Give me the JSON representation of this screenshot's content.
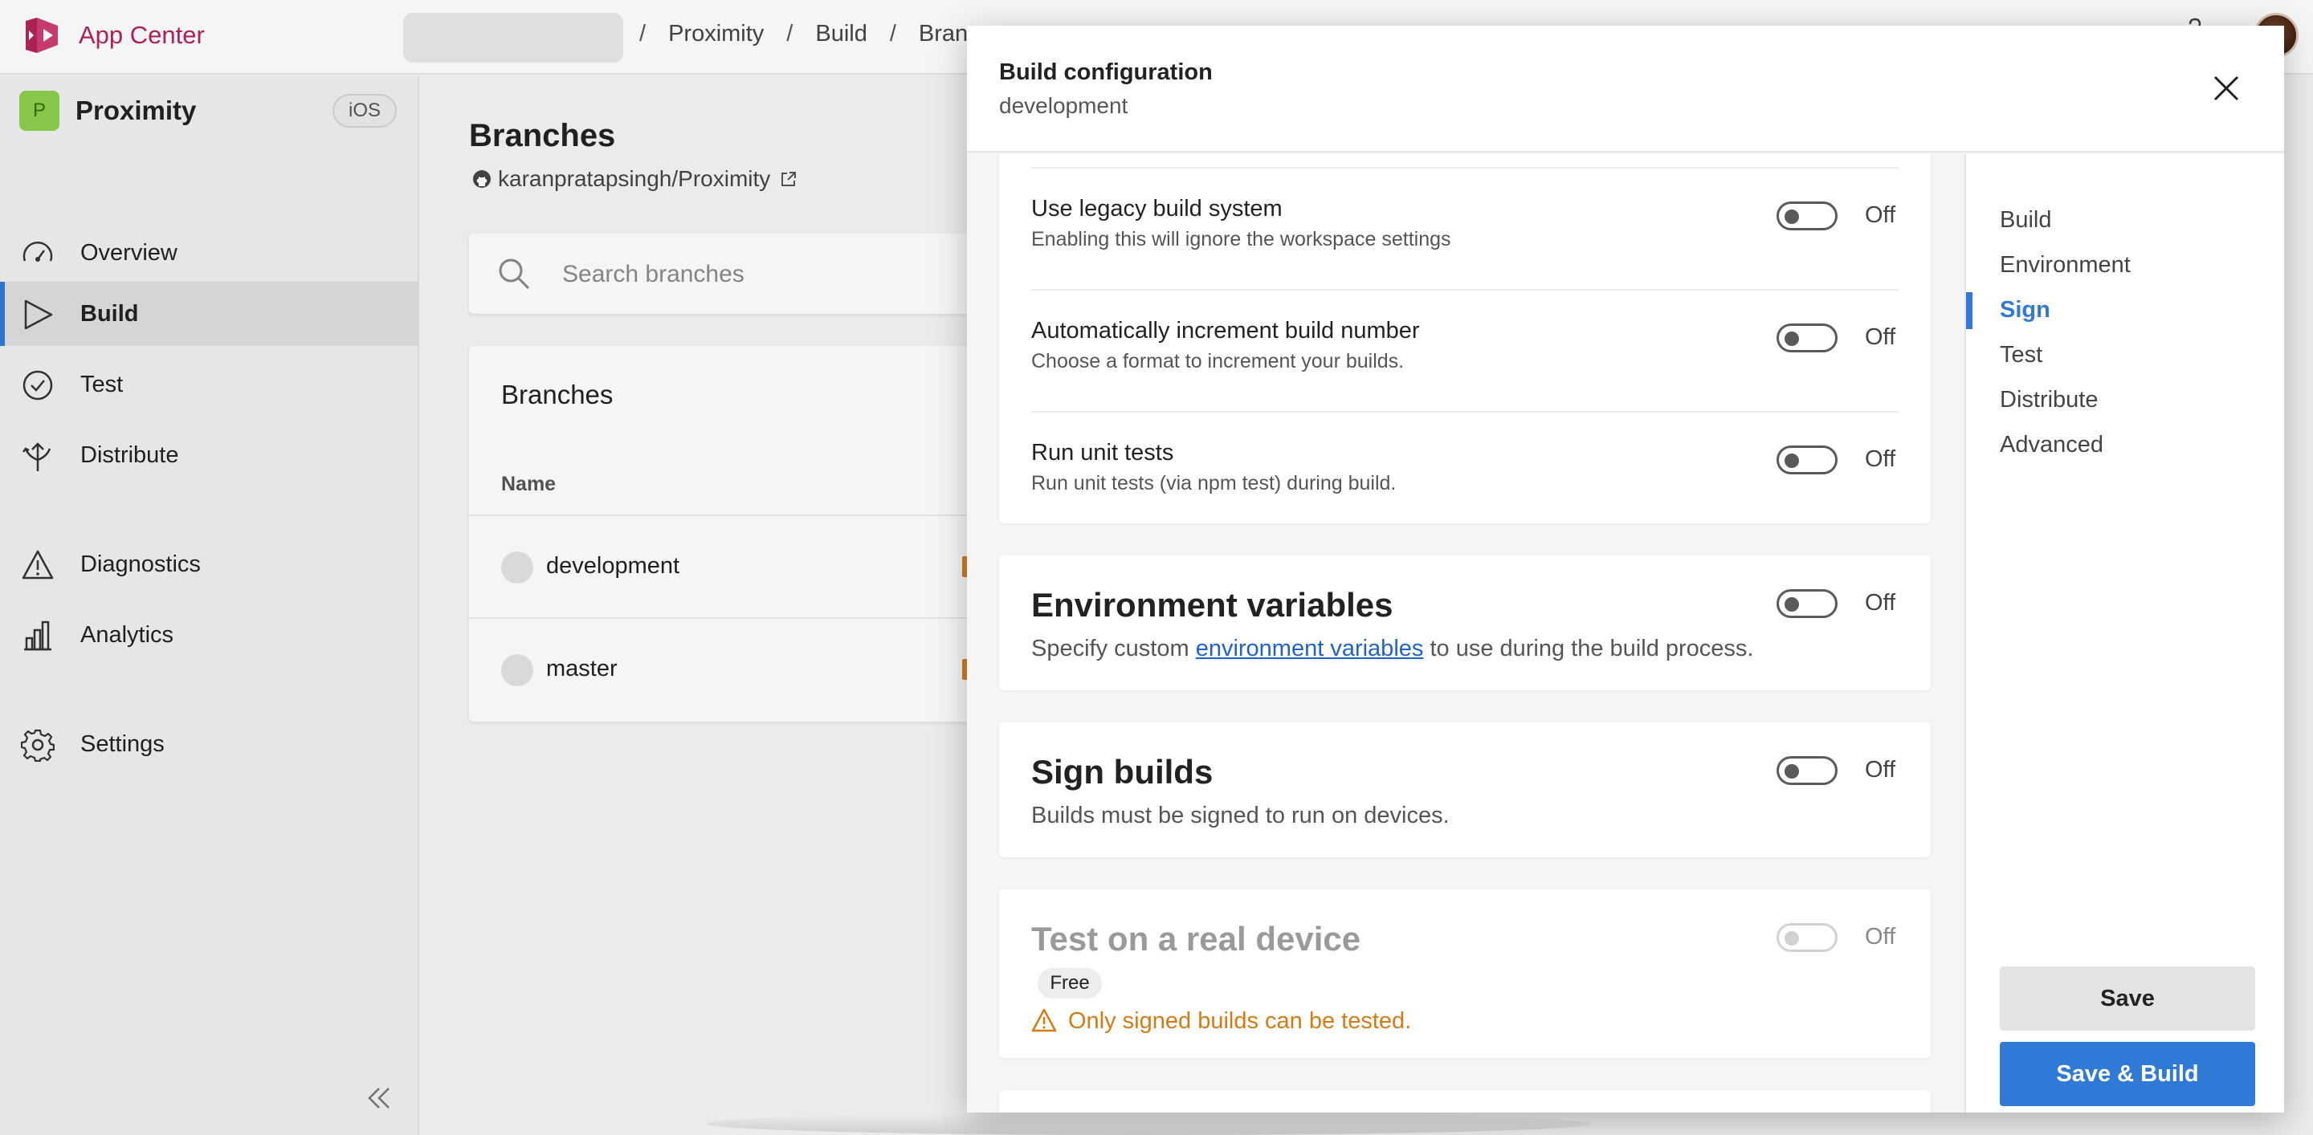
{
  "app": {
    "title": "App Center",
    "breadcrumb": [
      "Proximity",
      "Build",
      "Bran"
    ]
  },
  "sidebar": {
    "project_name": "Proximity",
    "project_initial": "P",
    "platform": "iOS",
    "items": [
      {
        "label": "Overview",
        "icon": "gauge-icon"
      },
      {
        "label": "Build",
        "icon": "play-icon",
        "active": true
      },
      {
        "label": "Test",
        "icon": "check-circle-icon"
      },
      {
        "label": "Distribute",
        "icon": "distribute-icon"
      },
      {
        "label": "Diagnostics",
        "icon": "warning-icon"
      },
      {
        "label": "Analytics",
        "icon": "bar-chart-icon"
      },
      {
        "label": "Settings",
        "icon": "gear-icon"
      }
    ]
  },
  "main": {
    "title": "Branches",
    "repo": "karanpratapsingh/Proximity",
    "search_placeholder": "Search branches",
    "card_title": "Branches",
    "column_name": "Name",
    "branches": [
      "development",
      "master"
    ]
  },
  "modal": {
    "title": "Build configuration",
    "subtitle": "development",
    "settings": [
      {
        "title": "Use legacy build system",
        "desc": "Enabling this will ignore the workspace settings",
        "state": "Off"
      },
      {
        "title": "Automatically increment build number",
        "desc": "Choose a format to increment your builds.",
        "state": "Off"
      },
      {
        "title": "Run unit tests",
        "desc": "Run unit tests (via npm test) during build.",
        "state": "Off"
      }
    ],
    "env_vars": {
      "title": "Environment variables",
      "desc_before": "Specify custom ",
      "link": "environment variables",
      "desc_after": " to use during the build process.",
      "state": "Off"
    },
    "sign": {
      "title": "Sign builds",
      "desc": "Builds must be signed to run on devices.",
      "state": "Off"
    },
    "test_device": {
      "title": "Test on a real device",
      "badge": "Free",
      "warning": "Only signed builds can be tested.",
      "state": "Off"
    },
    "nav": [
      "Build",
      "Environment",
      "Sign",
      "Test",
      "Distribute",
      "Advanced"
    ],
    "active_nav": "Sign",
    "save_label": "Save",
    "save_build_label": "Save & Build"
  },
  "colors": {
    "brand": "#b4235a",
    "accent": "#2f7ad6",
    "warning": "#d67a14"
  }
}
